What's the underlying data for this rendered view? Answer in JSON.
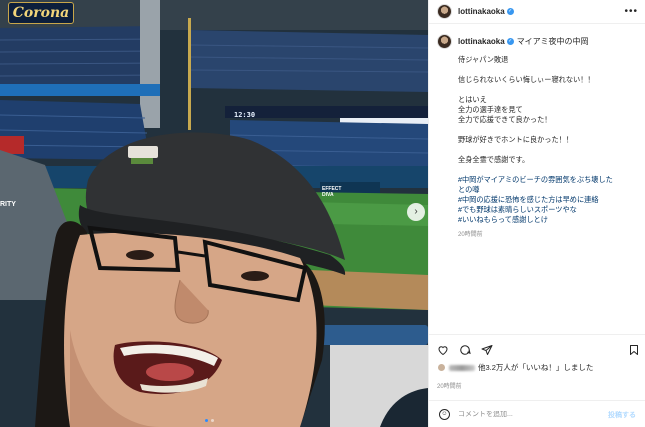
{
  "photo": {
    "sign_text": "Corona",
    "board_left": "",
    "board_mid": "12:30",
    "board_cols": "",
    "board_right": "",
    "dugout_text": "EFFECT\nDIVA",
    "sleeve_text": "RITY",
    "carousel_dots": 2,
    "active_dot": 0
  },
  "post_header": {
    "username": "lottinakaoka",
    "verified_icon": "✓",
    "more_icon": "•••"
  },
  "caption": {
    "username": "lottinakaoka",
    "location_text": "マイアミ夜中の中岡",
    "lines": [
      "侍ジャパン敗退",
      "",
      "信じられないくらい悔しぃー寝れない！！",
      "",
      "とはいえ",
      "全力の選手達を見て",
      "全力で応援できて良かった！",
      "",
      "野球が好きでホントに良かった！！",
      "",
      "全身全霊で感謝です。",
      "",
      "#中岡がマイアミのビーチの雰囲気をぶち壊した",
      "との噂",
      "#中岡の応援に恐怖を感じた方は早めに連絡",
      "#でも野球は素晴らしいスポーツやな",
      "#いいねもらって感謝しとけ"
    ],
    "time_ago": "20時間前"
  },
  "actions": {
    "like_icon": "heart-icon",
    "comment_icon": "comment-icon",
    "share_icon": "paper-plane-icon",
    "save_icon": "bookmark-icon"
  },
  "likes_text_pre": "他3.2万人が",
  "likes_text_quote": "「いいね！」しました",
  "date_text": "20時間前",
  "comment_box": {
    "placeholder": "コメントを追加...",
    "post_label": "投稿する"
  },
  "colors": {
    "link": "#00376b",
    "verified": "#3897f0",
    "post_button": "#b3dbff"
  }
}
